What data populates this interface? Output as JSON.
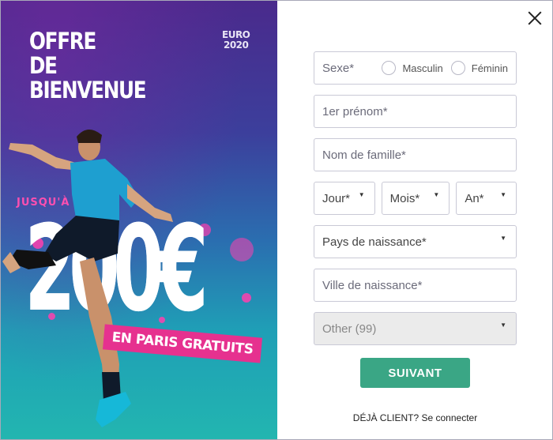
{
  "promo": {
    "title_lines": [
      "OFFRE",
      "DE",
      "BIENVENUE"
    ],
    "euro_logo_lines": [
      "EURO",
      "2020"
    ],
    "jusqu": "JUSQU'À",
    "amount": "200€",
    "badge": "EN PARIS GRATUITS",
    "accent_color": "#e6318f"
  },
  "close": {
    "icon": "close-icon"
  },
  "form": {
    "sexe_label": "Sexe*",
    "sexe_options": [
      "Masculin",
      "Féminin"
    ],
    "first_name_placeholder": "1er prénom*",
    "last_name_placeholder": "Nom de famille*",
    "day_label": "Jour*",
    "month_label": "Mois*",
    "year_label": "An*",
    "country_label": "Pays de naissance*",
    "city_placeholder": "Ville de naissance*",
    "other_label": "Other (99)",
    "caret": "▼",
    "submit_label": "SUIVANT",
    "submit_color": "#3aa685"
  },
  "footer": {
    "client_text": "DÉJÀ CLIENT?",
    "login_link": "Se connecter"
  }
}
